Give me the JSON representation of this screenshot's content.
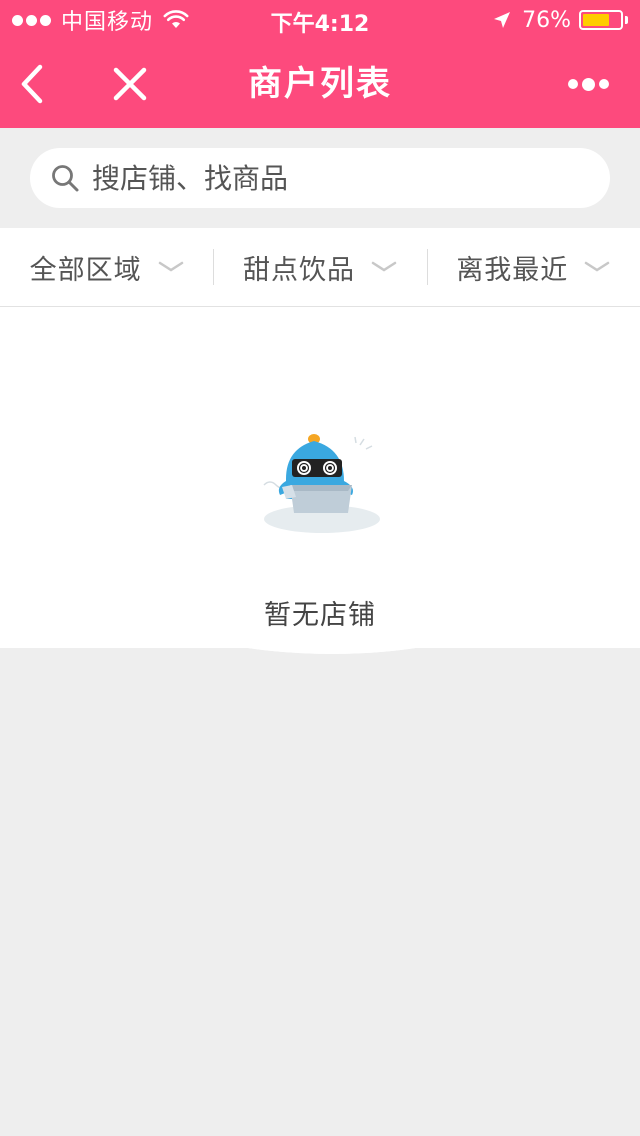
{
  "status_bar": {
    "carrier": "中国移动",
    "time": "下午4:12",
    "battery_percent": "76%",
    "battery_level": 0.76,
    "signal_bars": 3,
    "signal_total": 5,
    "battery_color": "#ffcc00"
  },
  "nav": {
    "title": "商户列表",
    "back_icon": "chevron-left-icon",
    "close_icon": "close-icon",
    "more_icon": "more-icon",
    "background": "#fd4a7d"
  },
  "search": {
    "placeholder": "搜店铺、找商品",
    "value": ""
  },
  "filters": [
    {
      "label": "全部区域"
    },
    {
      "label": "甜点饮品"
    },
    {
      "label": "离我最近"
    }
  ],
  "empty_state": {
    "message": "暂无店铺",
    "icon": "empty-box-mascot-icon"
  }
}
